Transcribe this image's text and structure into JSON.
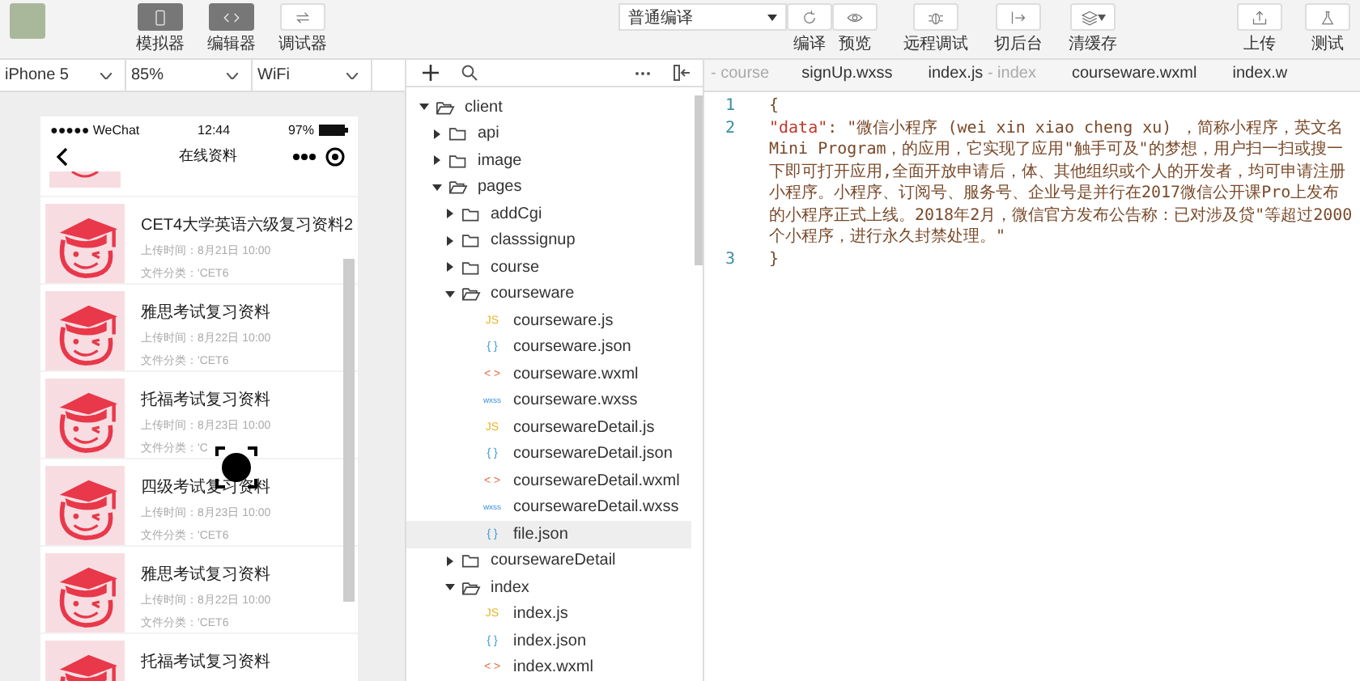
{
  "toolbar": {
    "modes": [
      {
        "label": "模拟器",
        "selected": true
      },
      {
        "label": "编辑器",
        "selected": true
      },
      {
        "label": "调试器",
        "selected": false
      }
    ],
    "compile_mode": "普通编译",
    "actions": [
      {
        "label": "编译"
      },
      {
        "label": "预览"
      }
    ],
    "tools": [
      {
        "label": "远程调试"
      },
      {
        "label": "切后台"
      },
      {
        "label": "清缓存"
      }
    ],
    "right_tools": [
      {
        "label": "上传"
      },
      {
        "label": "测试"
      }
    ]
  },
  "simulator": {
    "device": "iPhone 5",
    "zoom": "85%",
    "network": "WiFi",
    "phone": {
      "carrier": "●●●●● WeChat",
      "time": "12:44",
      "battery": "97%",
      "title": "在线资料",
      "items": [
        {
          "title": "CET4大学英语六级复习资料2",
          "upload_time": "上传时间：8月21日 10:00",
          "category": "文件分类：'CET6"
        },
        {
          "title": "雅思考试复习资料",
          "upload_time": "上传时间：8月22日 10:00",
          "category": "文件分类：'CET6"
        },
        {
          "title": "托福考试复习资料",
          "upload_time": "上传时间：8月23日 10:00",
          "category": "文件分类：'C"
        },
        {
          "title": "四级考试复习资料",
          "upload_time": "上传时间：8月23日 10:00",
          "category": "文件分类：'CET6"
        },
        {
          "title": "雅思考试复习资料",
          "upload_time": "上传时间：8月22日 10:00",
          "category": "文件分类：'CET6"
        },
        {
          "title": "托福考试复习资料"
        }
      ]
    }
  },
  "file_tree": {
    "items": [
      {
        "name": "client",
        "kind": "folder",
        "expanded": true,
        "selected": false,
        "children": [
          {
            "name": "api",
            "kind": "folder",
            "expanded": false,
            "selected": false
          },
          {
            "name": "image",
            "kind": "folder",
            "expanded": false,
            "selected": false
          },
          {
            "name": "pages",
            "kind": "folder",
            "expanded": true,
            "selected": false,
            "children": [
              {
                "name": "addCgi",
                "kind": "folder",
                "expanded": false,
                "selected": false
              },
              {
                "name": "classsignup",
                "kind": "folder",
                "expanded": false,
                "selected": false
              },
              {
                "name": "course",
                "kind": "folder",
                "expanded": false,
                "selected": false
              },
              {
                "name": "courseware",
                "kind": "folder",
                "expanded": true,
                "selected": false,
                "children": [
                  {
                    "name": "courseware.js",
                    "kind": "js",
                    "badge": "JS",
                    "selected": false
                  },
                  {
                    "name": "courseware.json",
                    "kind": "json",
                    "badge": "{ }",
                    "selected": false
                  },
                  {
                    "name": "courseware.wxml",
                    "kind": "wxml",
                    "badge": "< >",
                    "selected": false
                  },
                  {
                    "name": "courseware.wxss",
                    "kind": "wxss",
                    "badge": "wxss",
                    "selected": false
                  },
                  {
                    "name": "coursewareDetail.js",
                    "kind": "js",
                    "badge": "JS",
                    "selected": false
                  },
                  {
                    "name": "coursewareDetail.json",
                    "kind": "json",
                    "badge": "{ }",
                    "selected": false
                  },
                  {
                    "name": "coursewareDetail.wxml",
                    "kind": "wxml",
                    "badge": "< >",
                    "selected": false
                  },
                  {
                    "name": "coursewareDetail.wxss",
                    "kind": "wxss",
                    "badge": "wxss",
                    "selected": false
                  },
                  {
                    "name": "file.json",
                    "kind": "json",
                    "badge": "{ }",
                    "selected": true
                  }
                ]
              },
              {
                "name": "coursewareDetail",
                "kind": "folder",
                "expanded": false,
                "selected": false
              },
              {
                "name": "index",
                "kind": "folder",
                "expanded": true,
                "selected": false,
                "children": [
                  {
                    "name": "index.js",
                    "kind": "js",
                    "badge": "JS",
                    "selected": false
                  },
                  {
                    "name": "index.json",
                    "kind": "json",
                    "badge": "{ }",
                    "selected": false
                  },
                  {
                    "name": "index.wxml",
                    "kind": "wxml",
                    "badge": "< >",
                    "selected": false
                  }
                ]
              }
            ]
          }
        ]
      }
    ]
  },
  "editor": {
    "tabs": [
      {
        "name": "- course"
      },
      {
        "name": "signUp.wxss"
      },
      {
        "name": "index.js",
        "suffix": "- index"
      },
      {
        "name": "courseware.wxml"
      },
      {
        "name": "index.w"
      }
    ],
    "lines": [
      {
        "number": "1",
        "text": "{"
      },
      {
        "number": "2",
        "key": "\"data\"",
        "text": ": \"微信小程序 (wei xin xiao cheng xu) ，简称小程序，英文名Mini Program，的应用，它实现了应用\"触手可及\"的梦想，用户扫一扫或搜一下即可打开应用,全面开放申请后，体、其他组织或个人的开发者，均可申请注册小程序。小程序、订阅号、服务号、企业号是并行在2017微信公开课Pro上发布的小程序正式上线。2018年2月，微信官方发布公告称：已对涉及贷\"等超过2000个小程序，进行永久封禁处理。\""
      },
      {
        "number": "3",
        "text": "}"
      }
    ]
  }
}
